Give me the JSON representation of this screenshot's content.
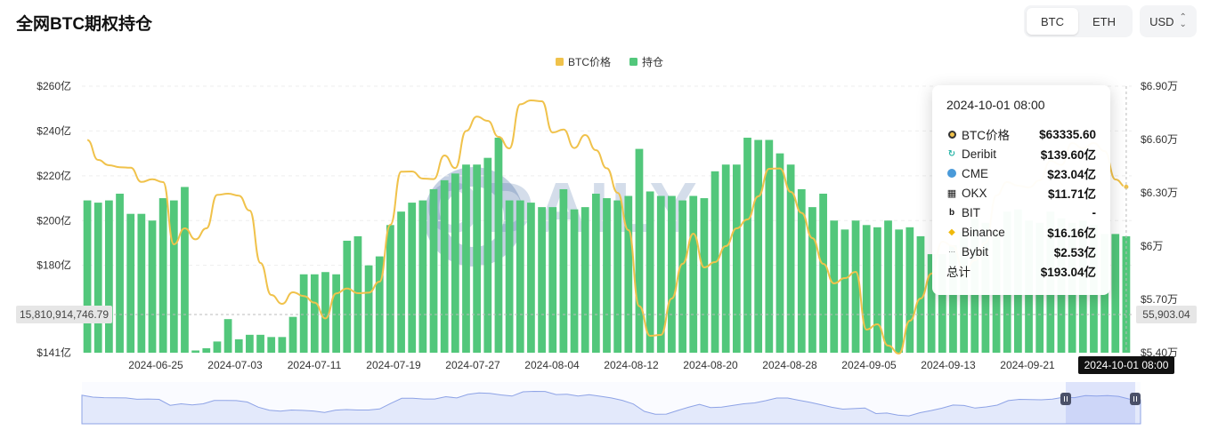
{
  "header": {
    "title": "全网BTC期权持仓",
    "tabs": [
      {
        "label": "BTC",
        "active": true
      },
      {
        "label": "ETH",
        "active": false
      }
    ],
    "currency": "USD"
  },
  "legend": [
    {
      "label": "BTC价格",
      "color": "#f0c24b"
    },
    {
      "label": "持仓",
      "color": "#52c77b"
    }
  ],
  "crosshair": {
    "left_label": "15,810,914,746.79",
    "right_label": "55,903.04",
    "x_label": "2024-10-01 08:00"
  },
  "watermark": "ODAILY",
  "tooltip": {
    "time": "2024-10-01 08:00",
    "rows": [
      {
        "icon": "btc-price-icon",
        "name": "BTC价格",
        "value": "$63335.60"
      },
      {
        "icon": "deribit-icon",
        "name": "Deribit",
        "value": "$139.60亿"
      },
      {
        "icon": "cme-icon",
        "name": "CME",
        "value": "$23.04亿"
      },
      {
        "icon": "okx-icon",
        "name": "OKX",
        "value": "$11.71亿"
      },
      {
        "icon": "bit-icon",
        "name": "BIT",
        "value": "-"
      },
      {
        "icon": "binance-icon",
        "name": "Binance",
        "value": "$16.16亿"
      },
      {
        "icon": "bybit-icon",
        "name": "Bybit",
        "value": "$2.53亿"
      },
      {
        "icon": "total-icon",
        "name": "总计",
        "value": "$193.04亿"
      }
    ]
  },
  "chart_data": {
    "type": "bar",
    "title": "全网BTC期权持仓",
    "x_ticks": [
      "2024-06-25",
      "2024-07-03",
      "2024-07-11",
      "2024-07-19",
      "2024-07-27",
      "2024-08-04",
      "2024-08-12",
      "2024-08-20",
      "2024-08-28",
      "2024-09-05",
      "2024-09-13",
      "2024-09-21",
      "2024-10-01 08:00"
    ],
    "y_left_ticks": [
      "$260亿",
      "$240亿",
      "$220亿",
      "$200亿",
      "$180亿",
      "$141亿"
    ],
    "y_right_ticks": [
      "$6.90万",
      "$6.60万",
      "$6.30万",
      "$6万",
      "$5.70万",
      "$5.40万"
    ],
    "ylim_left": [
      141,
      260
    ],
    "ylim_right": [
      54000,
      69000
    ],
    "series": [
      {
        "name": "持仓",
        "axis": "left",
        "color": "#52c77b",
        "values": [
          209,
          208,
          209,
          212,
          203,
          203,
          200,
          210,
          209,
          215,
          142,
          143,
          146,
          156,
          147,
          149,
          149,
          148,
          148,
          157,
          176,
          176,
          177,
          176,
          191,
          193,
          180,
          184,
          198,
          204,
          208,
          209,
          214,
          218,
          221,
          225,
          225,
          228,
          237,
          209,
          209,
          208,
          206,
          206,
          214,
          205,
          206,
          212,
          210,
          209,
          211,
          232,
          213,
          211,
          211,
          209,
          211,
          210,
          222,
          225,
          225,
          237,
          236,
          236,
          230,
          225,
          214,
          206,
          212,
          200,
          196,
          200,
          198,
          197,
          200,
          196,
          197,
          193,
          185,
          185,
          189,
          195,
          201,
          199,
          195,
          204,
          205,
          200,
          199,
          204,
          201,
          199,
          200,
          198,
          194,
          194,
          193
        ],
        "note": "bars from 2024-06-22 to 2024-10-01"
      },
      {
        "name": "BTC价格",
        "axis": "right",
        "color": "#f0c24b",
        "values": [
          65970,
          64850,
          64550,
          64440,
          64410,
          63610,
          63760,
          63600,
          60100,
          61000,
          60380,
          61000,
          62880,
          62950,
          62840,
          62000,
          59050,
          57250,
          56750,
          57400,
          57190,
          56820,
          55930,
          57340,
          57610,
          57350,
          57380,
          58000,
          61200,
          64190,
          64200,
          63800,
          63770,
          65100,
          64390,
          66480,
          67290,
          67050,
          66150,
          65500,
          67980,
          68200,
          68150,
          66390,
          66560,
          65520,
          66250,
          65400,
          64380,
          63000,
          60900,
          56620,
          54950,
          55000,
          57050,
          59000,
          60700,
          58800,
          59100,
          60000,
          61000,
          61500,
          62800,
          64350,
          64370,
          63050,
          61870,
          60450,
          59000,
          57900,
          58200,
          58550,
          55300,
          55600,
          54400,
          53950,
          55800,
          57050,
          58450,
          60250,
          60000,
          58500,
          59200,
          60200,
          62850,
          63600,
          63400,
          63300,
          63700,
          64800,
          64570,
          65800,
          65500,
          65800,
          65350,
          63750,
          63330
        ],
        "note": "daily price path 2024-06-22 to 2024-10-01"
      }
    ],
    "legend_position": "top-center",
    "grid": true
  }
}
